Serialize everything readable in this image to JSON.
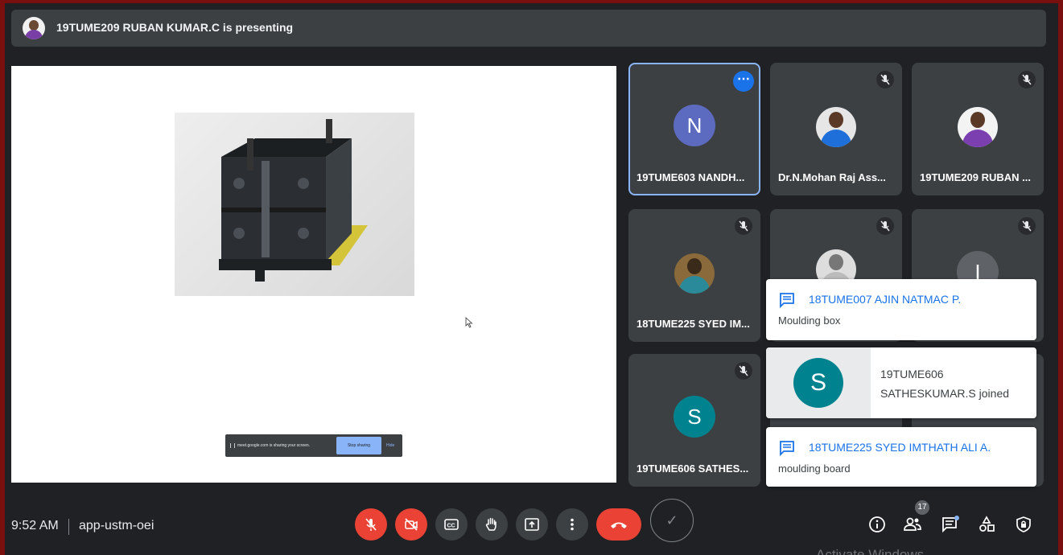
{
  "presenting_bar": {
    "text": "19TUME209 RUBAN KUMAR.C is presenting"
  },
  "share_notice": {
    "text": "meet.google.com is sharing your screen.",
    "stop_label": "Stop sharing",
    "hide_label": "Hide"
  },
  "tiles": [
    {
      "name": "19TUME603 NANDH...",
      "avatar_letter": "N",
      "avatar_color": "#5c6bc0"
    },
    {
      "name": "Dr.N.Mohan Raj Ass..."
    },
    {
      "name": "19TUME209 RUBAN ..."
    },
    {
      "name": "18TUME225 SYED IM..."
    },
    {
      "name": "",
      "avatar_letter": "I",
      "avatar_color": "#5f6368"
    },
    {
      "name": "19TUME606 SATHES...",
      "avatar_letter": "S",
      "avatar_color": "#00838f"
    }
  ],
  "toasts": [
    {
      "sender": "18TUME007 AJIN NATMAC P.",
      "message": "Moulding box"
    },
    {
      "avatar_letter": "S",
      "line1": "19TUME606",
      "line2": "SATHESKUMAR.S joined"
    },
    {
      "sender": "18TUME225 SYED IMTHATH ALI A.",
      "message": "moulding board"
    }
  ],
  "bottom_bar": {
    "time": "9:52 AM",
    "meeting_code": "app-ustm-oei",
    "participant_count": "17"
  },
  "watermark": "Activate Windows",
  "colors": {
    "accent": "#8ab4f8",
    "danger": "#ea4335",
    "bar": "#3c4043"
  }
}
